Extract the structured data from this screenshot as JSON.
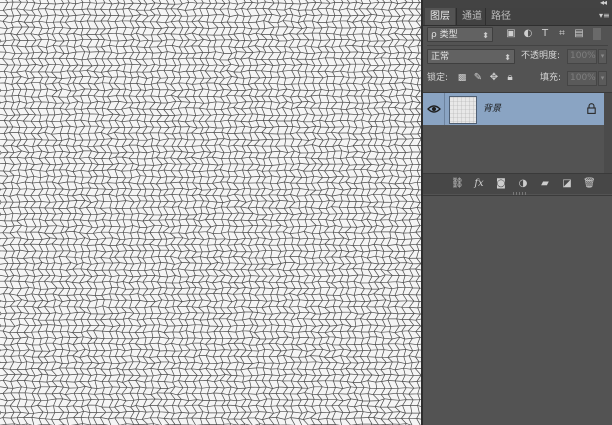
{
  "canvas": {
    "texture": "stained-glass"
  },
  "panel": {
    "collapse_icon": "double-chevron-right-icon",
    "menu_icon": "panel-menu-icon",
    "tabs": [
      {
        "label": "图层",
        "active": true
      },
      {
        "label": "通道",
        "active": false
      },
      {
        "label": "路径",
        "active": false
      }
    ],
    "filter": {
      "icon": "search-icon",
      "label": "ρ 类型",
      "filter_icons": [
        "image-filter-icon",
        "adjustment-filter-icon",
        "type-filter-icon",
        "shape-filter-icon",
        "smart-object-filter-icon"
      ]
    },
    "blend": {
      "mode": "正常",
      "opacity_label": "不透明度:",
      "opacity_value": "100%"
    },
    "lock": {
      "label": "锁定:",
      "icons": [
        "lock-transparent-icon",
        "lock-image-icon",
        "lock-position-icon",
        "lock-all-icon"
      ],
      "fill_label": "填充:",
      "fill_value": "100%"
    },
    "layers": [
      {
        "name": "背景",
        "visible": true,
        "locked": true,
        "selected": true
      }
    ],
    "bottom_icons": [
      "link-icon",
      "fx-icon",
      "mask-icon",
      "adjustment-icon",
      "folder-icon",
      "new-layer-icon",
      "trash-icon"
    ],
    "colors": {
      "background": "#535353",
      "selected_layer": "#8aa4c3",
      "tabs": "#424242"
    }
  }
}
